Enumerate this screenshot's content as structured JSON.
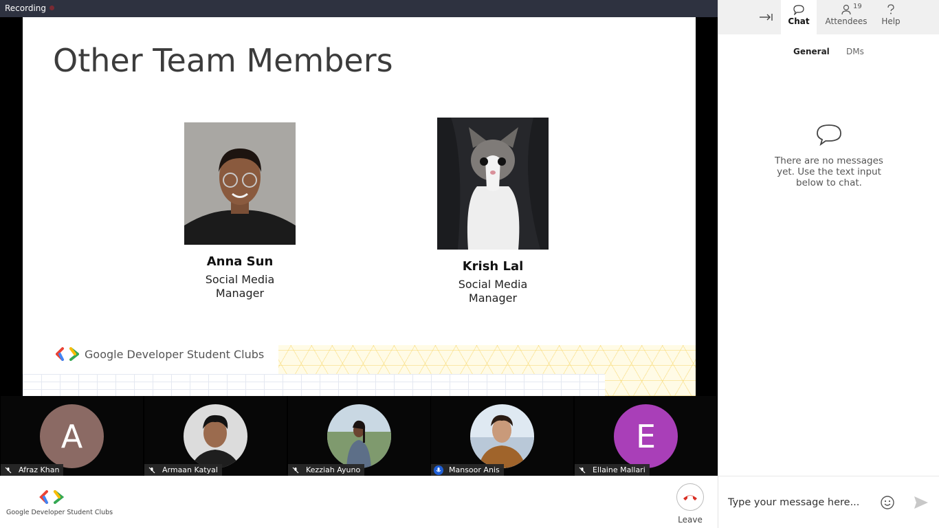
{
  "recording": {
    "label": "Recording"
  },
  "slide": {
    "title": "Other Team Members",
    "members": [
      {
        "name": "Anna Sun",
        "role": "Social Media Manager"
      },
      {
        "name": "Krish Lal",
        "role": "Social Media Manager"
      }
    ],
    "footer_brand": "Google Developer Student Clubs"
  },
  "participants": [
    {
      "name": "Afraz Khan",
      "avatar_letter": "A",
      "avatar_color": "#8b6a64",
      "mic": "muted"
    },
    {
      "name": "Armaan Katyal",
      "avatar_letter": "",
      "avatar_color": "#d8d8d8",
      "mic": "muted"
    },
    {
      "name": "Kezziah Ayuno",
      "avatar_letter": "",
      "avatar_color": "#b7c9b2",
      "mic": "muted"
    },
    {
      "name": "Mansoor Anis",
      "avatar_letter": "",
      "avatar_color": "#c9a27a",
      "mic": "active"
    },
    {
      "name": "Ellaine Mallari",
      "avatar_letter": "E",
      "avatar_color": "#a93fb8",
      "mic": "muted"
    }
  ],
  "bottom_bar": {
    "brand": "Google Developer Student Clubs",
    "leave_label": "Leave"
  },
  "panel": {
    "tabs": [
      {
        "label": "Chat",
        "icon": "chat-bubble-icon"
      },
      {
        "label": "Attendees",
        "icon": "person-icon",
        "badge": "19"
      },
      {
        "label": "Help",
        "icon": "question-icon"
      }
    ],
    "subtabs": {
      "general": "General",
      "dms": "DMs"
    },
    "empty_message": "There are no messages yet. Use the text input below to chat.",
    "input_placeholder": "Type your message here..."
  },
  "colors": {
    "leave": "#d93025",
    "mic_active": "#1f5fd6",
    "recording_bar": "#2e3240"
  }
}
